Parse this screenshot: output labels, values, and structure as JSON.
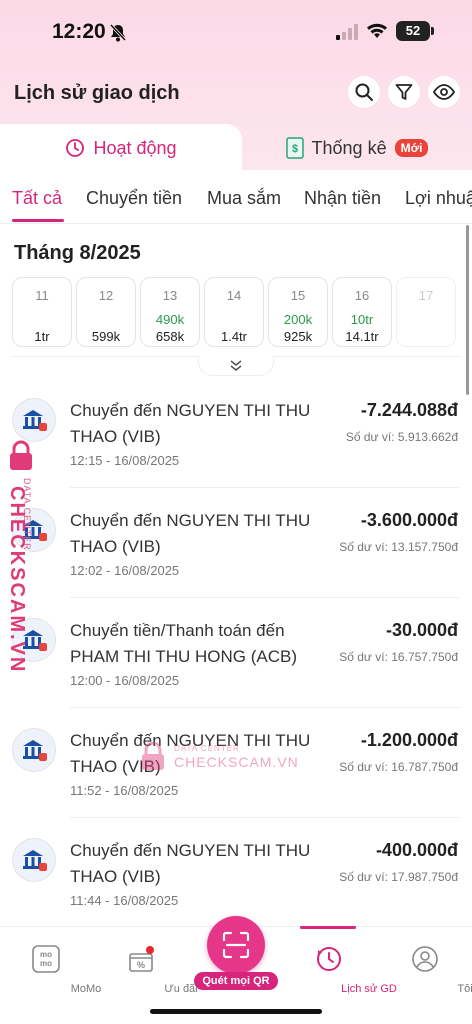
{
  "status_bar": {
    "time": "12:20",
    "battery": "52"
  },
  "header": {
    "title": "Lịch sử giao dịch"
  },
  "tabs": [
    {
      "label": "Hoạt động"
    },
    {
      "label": "Thống kê",
      "badge": "Mới"
    }
  ],
  "filters": [
    "Tất cả",
    "Chuyển tiền",
    "Mua sắm",
    "Nhận tiền",
    "Lợi nhuận"
  ],
  "month": "Tháng 8/2025",
  "days": [
    {
      "day": "11",
      "in": "",
      "out": "1tr"
    },
    {
      "day": "12",
      "in": "",
      "out": "599k"
    },
    {
      "day": "13",
      "in": "490k",
      "out": "658k"
    },
    {
      "day": "14",
      "in": "",
      "out": "1.4tr"
    },
    {
      "day": "15",
      "in": "200k",
      "out": "925k"
    },
    {
      "day": "16",
      "in": "10tr",
      "out": "14.1tr"
    },
    {
      "day": "17",
      "in": "",
      "out": ""
    }
  ],
  "transactions": [
    {
      "title": "Chuyển đến NGUYEN THI THU THAO (VIB)",
      "amount": "-7.244.088đ",
      "balance": "Số dư ví: 5.913.662đ",
      "time": "12:15 - 16/08/2025"
    },
    {
      "title": "Chuyển đến NGUYEN THI THU THAO (VIB)",
      "amount": "-3.600.000đ",
      "balance": "Số dư ví: 13.157.750đ",
      "time": "12:02 - 16/08/2025"
    },
    {
      "title": "Chuyển tiền/Thanh toán đến PHAM THI THU HONG (ACB)",
      "amount": "-30.000đ",
      "balance": "Số dư ví: 16.757.750đ",
      "time": "12:00 - 16/08/2025"
    },
    {
      "title": "Chuyển đến NGUYEN THI THU THAO (VIB)",
      "amount": "-1.200.000đ",
      "balance": "Số dư ví: 16.787.750đ",
      "time": "11:52 - 16/08/2025"
    },
    {
      "title": "Chuyển đến NGUYEN THI THU THAO (VIB)",
      "amount": "-400.000đ",
      "balance": "Số dư ví: 17.987.750đ",
      "time": "11:44 - 16/08/2025"
    }
  ],
  "watermark": {
    "line1": "DATA CENTER",
    "line2": "CHECKSCAM.VN"
  },
  "tabbar": {
    "items": [
      {
        "label": "MoMo",
        "icon": "momo-icon"
      },
      {
        "label": "Ưu đãi",
        "icon": "gift-icon"
      },
      {
        "label": "Lịch sử GD",
        "icon": "history-icon"
      },
      {
        "label": "Tôi",
        "icon": "user-icon"
      }
    ],
    "qr_label": "Quét mọi QR"
  },
  "colors": {
    "accent": "#d6257a",
    "income": "#2a9a4a",
    "badge": "#e8443a"
  }
}
